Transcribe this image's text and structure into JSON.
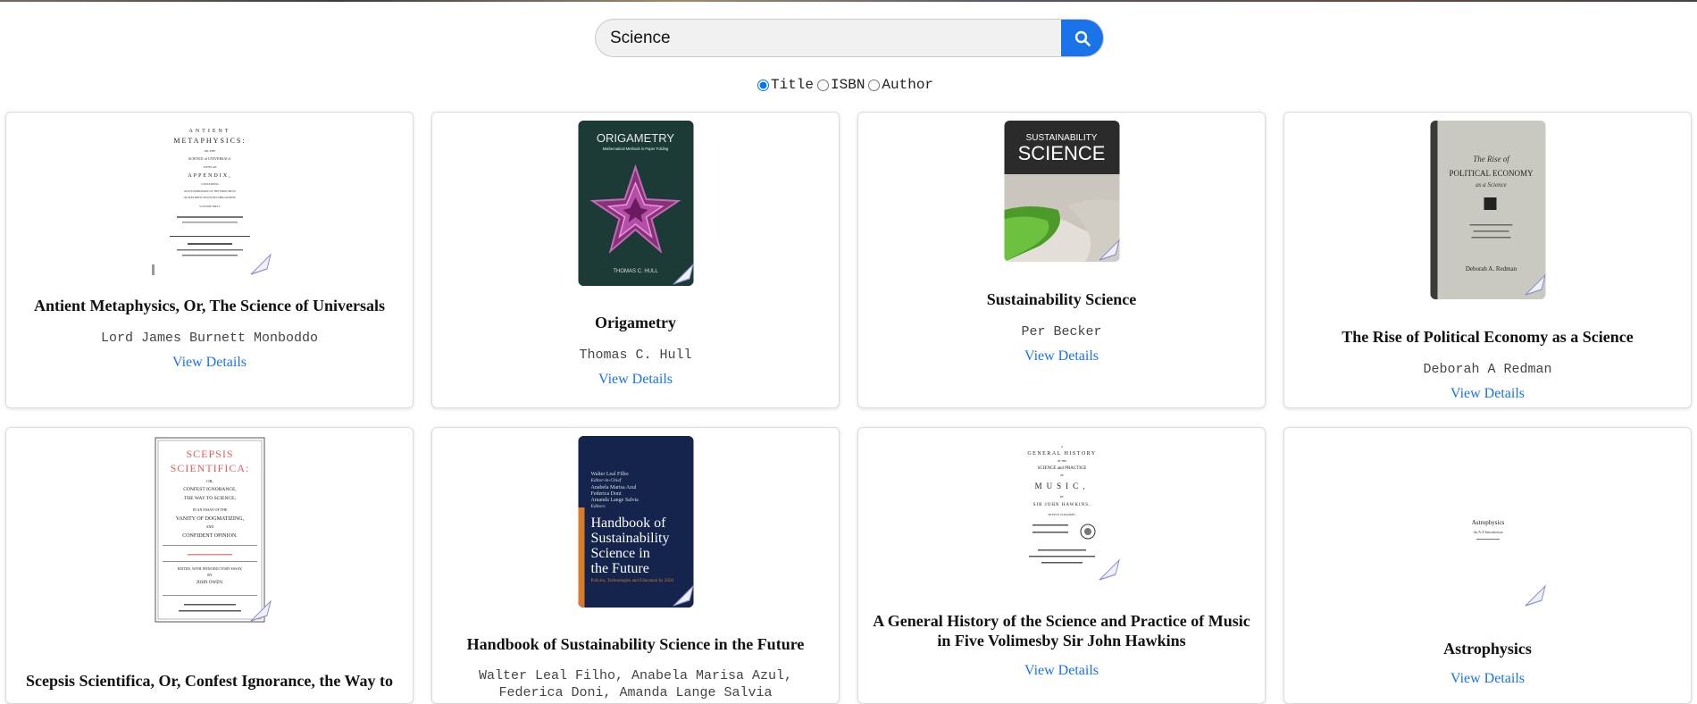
{
  "search": {
    "query": "Science",
    "button_icon": "search-icon",
    "accent": "#1a73e8"
  },
  "filters": [
    {
      "label": "Title",
      "checked": true
    },
    {
      "label": "ISBN",
      "checked": false
    },
    {
      "label": "Author",
      "checked": false
    }
  ],
  "books": [
    {
      "title": "Antient Metaphysics, Or, The Science of Universals",
      "author": "Lord James Burnett Monboddo",
      "link": "View Details",
      "cover": {
        "lines": [
          "ANTIENT",
          "METAPHYSICS:",
          "OR THE",
          "SCIENCE of UNIVERSALS.",
          "WITH AN",
          "APPENDIX,",
          "CONTAINING",
          "AN EXAMINATION OF THE PRINCIPLES",
          "OF MATTHEW NEWTON'S PHILOSOPHY.",
          "VOLUME FIRST."
        ]
      }
    },
    {
      "title": "Origametry",
      "author": "Thomas C. Hull",
      "link": "View Details",
      "cover": {
        "title": "ORIGAMETRY",
        "subtitle": "Mathematical Methods in Paper Folding",
        "author": "THOMAS C. HULL"
      }
    },
    {
      "title": "Sustainability Science",
      "author": "Per Becker",
      "link": "View Details",
      "cover": {
        "line1": "SUSTAINABILITY",
        "line2": "SCIENCE"
      }
    },
    {
      "title": "The Rise of Political Economy as a Science",
      "author": "Deborah A Redman",
      "link": "View Details",
      "cover": {
        "line1": "The Rise of",
        "line2": "POLITICAL ECONOMY",
        "line3": "as a Science",
        "author": "Deborah A. Redman"
      }
    },
    {
      "title": "Scepsis Scientifica, Or, Confest Ignorance, the Way to",
      "author": "",
      "link": "",
      "cover": {
        "line1": "SCEPSIS",
        "line2": "SCIENTIFICA:",
        "lines": [
          "OR,",
          "CONFEST IGNORANCE,",
          "THE WAY TO SCIENCE;",
          "IN AN ESSAY OF THE",
          "VANITY OF DOGMATIZING,",
          "AND",
          "CONFIDENT OPINION.",
          "EDITED, WITH INTRODUCTORY ESSAY,",
          "BY",
          "JOHN OWEN."
        ]
      }
    },
    {
      "title": "Handbook of Sustainability Science in the Future",
      "author": "Walter Leal Filho, Anabela Marisa Azul, Federica Doni, Amanda Lange Salvia",
      "link": "",
      "cover": {
        "editors": [
          "Walter Leal Filho",
          "Editor-in-Chief",
          "Anabela Marisa Azul",
          "Federica Doni",
          "Amanda Lange Salvia",
          "Editors"
        ],
        "title": [
          "Handbook of",
          "Sustainability",
          "Science in",
          "the Future"
        ],
        "subtitle": "Policies, Technologies and Education by 2050"
      }
    },
    {
      "title": "A General History of the Science and Practice of Music in Five Volimesby Sir John Hawkins",
      "author": "",
      "link": "View Details",
      "cover": {
        "lines": [
          "A",
          "GENERAL HISTORY",
          "OF THE",
          "SCIENCE and PRACTICE",
          "OF",
          "MUSIC,",
          "BY",
          "SIR JOHN HAWKINS.",
          "IN FIVE VOLUMES."
        ]
      }
    },
    {
      "title": "Astrophysics",
      "author": "",
      "link": "View Details",
      "cover": {
        "title": "Astrophysics",
        "subtitle": "An A-Z Introduction"
      }
    }
  ]
}
